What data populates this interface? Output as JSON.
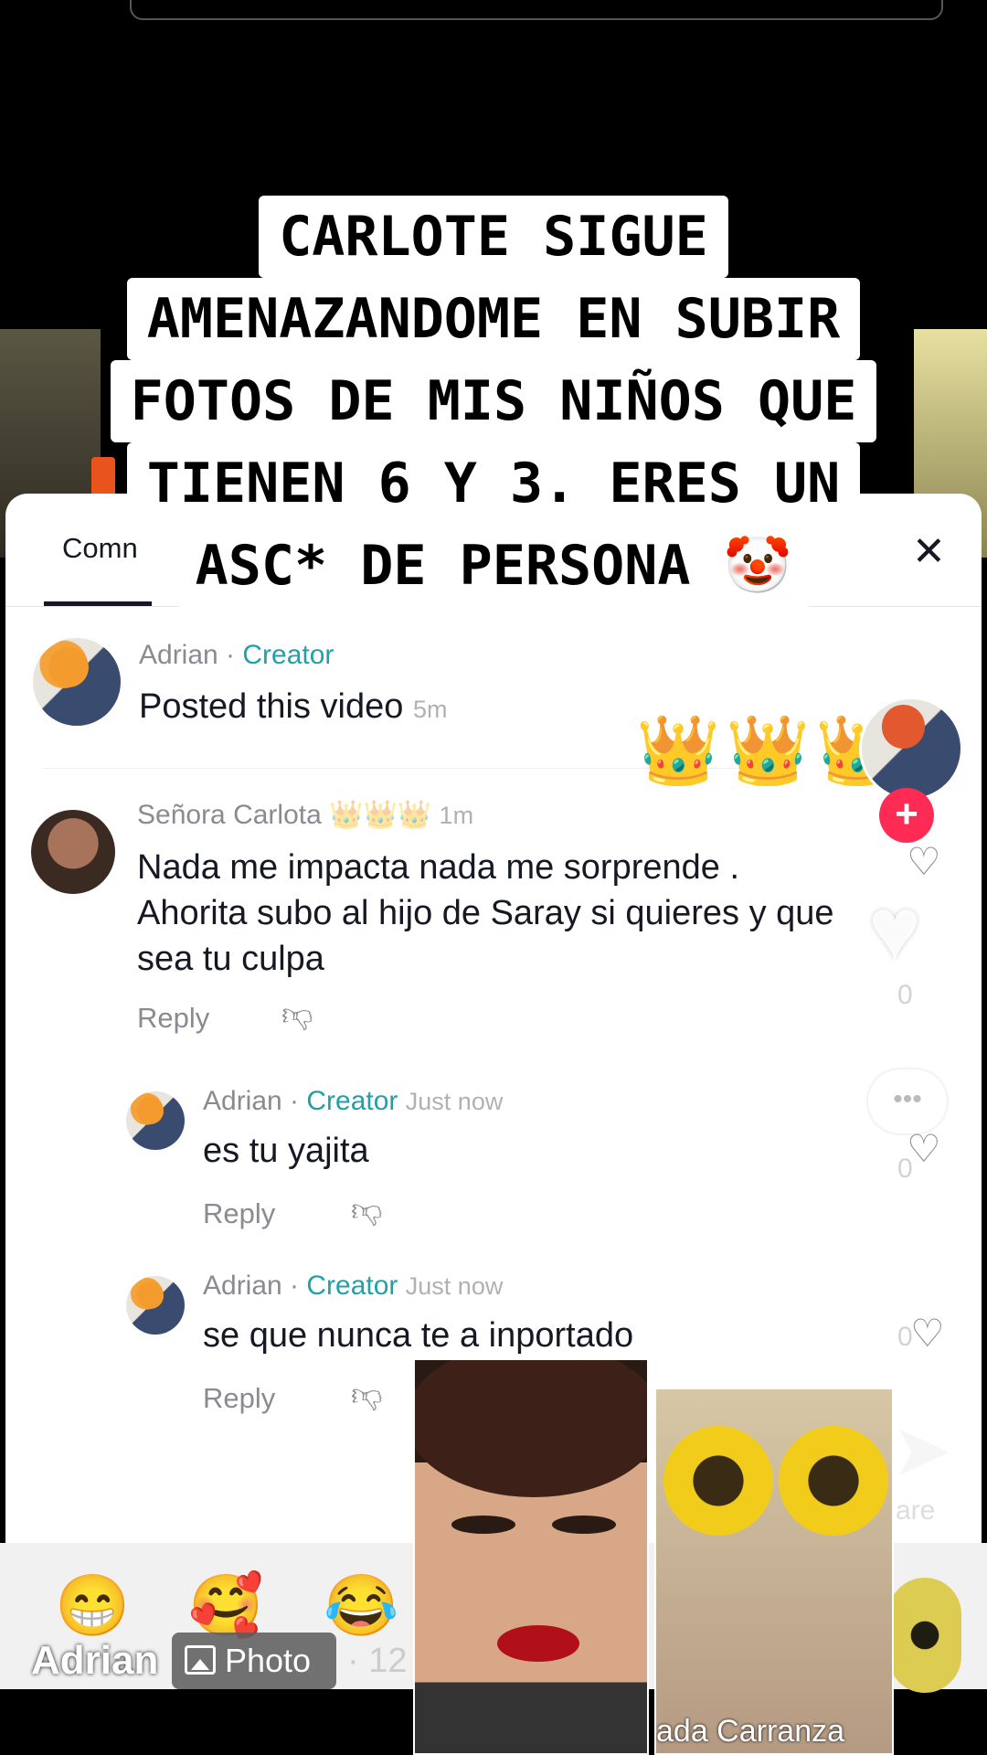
{
  "caption": {
    "lines": [
      "CARLOTE SIGUE",
      "AMENAZANDOME EN SUBIR",
      "FOTOS DE MIS NIÑOS QUE",
      "TIENEN 6 Y 3. ERES UN",
      "ASC* DE PERSONA 🤡"
    ]
  },
  "sheet": {
    "tab_label": "Comn",
    "close_glyph": "✕"
  },
  "comments": [
    {
      "author": "Adrian",
      "separator": " · ",
      "role": "Creator",
      "text": "Posted this video",
      "time": "5m"
    },
    {
      "author": "Señora Carlota",
      "badge": "👑👑👑",
      "time": "1m",
      "text": "Nada me impacta nada me sorprende . Ahorita subo al hijo de Saray si quieres y que sea tu culpa",
      "reply": "Reply"
    },
    {
      "author": "Adrian",
      "separator": " · ",
      "role": "Creator",
      "time": "Just now",
      "text": "es tu yajita",
      "reply": "Reply"
    },
    {
      "author": "Adrian",
      "separator": " · ",
      "role": "Creator",
      "time": "Just now",
      "text": "se que nunca te a inportado",
      "reply": "Reply"
    }
  ],
  "overlay": {
    "crowns": "👑👑👑",
    "plus": "+",
    "heart_counts": [
      "0",
      "0",
      "0"
    ],
    "bubble_dots": "•••",
    "share_label": "are"
  },
  "footer": {
    "emojis": [
      "😁",
      "🥰",
      "😂"
    ],
    "username": "Adrian",
    "photo_label": "Photo",
    "meta": "· 12"
  },
  "photos": {
    "right_caption": "ada Carranza"
  },
  "colors": {
    "creator": "#20a1a8",
    "follow": "#fe2c55"
  }
}
